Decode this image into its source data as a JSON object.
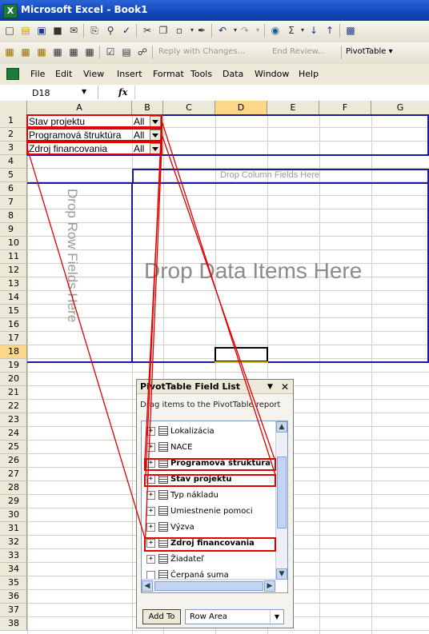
{
  "window": {
    "title": "Microsoft Excel - Book1",
    "app_icon": "X"
  },
  "toolbar_review": {
    "reply_label": "Reply with Changes...",
    "end_review_label": "End Review...",
    "pivottable_label": "PivotTable ▾"
  },
  "menu": {
    "items": [
      "File",
      "Edit",
      "View",
      "Insert",
      "Format",
      "Tools",
      "Data",
      "Window",
      "Help"
    ]
  },
  "formula_bar": {
    "name_box": "D18",
    "fx": "fx"
  },
  "columns": [
    "A",
    "B",
    "C",
    "D",
    "E",
    "F",
    "G"
  ],
  "rows": [
    "1",
    "2",
    "3",
    "4",
    "5",
    "6",
    "7",
    "8",
    "9",
    "10",
    "11",
    "12",
    "13",
    "14",
    "15",
    "16",
    "17",
    "18",
    "19",
    "20",
    "21",
    "22",
    "23",
    "24",
    "25",
    "26",
    "27",
    "28",
    "29",
    "30",
    "31",
    "32",
    "33",
    "34",
    "35",
    "36",
    "37",
    "38"
  ],
  "page_filters": [
    {
      "label": "Stav projektu",
      "value": "All"
    },
    {
      "label": "Programová štruktúra",
      "value": "All"
    },
    {
      "label": "Zdroj financovania",
      "value": "All"
    }
  ],
  "pivot_area": {
    "drop_column": "Drop Column Fields Here",
    "drop_row": "Drop Row Fields Here",
    "drop_data": "Drop Data Items Here"
  },
  "field_list": {
    "title": "PivotTable Field List",
    "description": "Drag items to the PivotTable report",
    "fields": [
      {
        "name": "Lokalizácia",
        "bold": false
      },
      {
        "name": "NACE",
        "bold": false
      },
      {
        "name": "Programová štruktúra",
        "bold": true
      },
      {
        "name": "Stav projektu",
        "bold": true
      },
      {
        "name": "Typ nákladu",
        "bold": false
      },
      {
        "name": "Umiestnenie pomoci",
        "bold": false
      },
      {
        "name": "Výzva",
        "bold": false
      },
      {
        "name": "Zdroj financovania",
        "bold": true
      },
      {
        "name": "Žiadateľ",
        "bold": false
      },
      {
        "name": "Čerpaná suma",
        "bold": false
      }
    ],
    "add_to_label": "Add To",
    "area_value": "Row Area"
  },
  "colors": {
    "accent_blue": "#1a1aa0",
    "highlight_red": "#e00000",
    "title_blue": "#1247b8"
  }
}
